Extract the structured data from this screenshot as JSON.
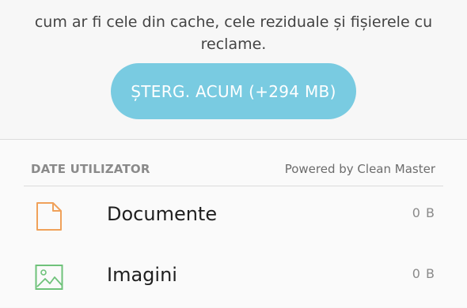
{
  "description": {
    "line1": "cum ar fi cele din cache, cele reziduale și fișierele cu",
    "line2": "reclame."
  },
  "clean_button": {
    "label": "ȘTERG. ACUM (+294 MB)"
  },
  "user_data": {
    "title": "DATE UTILIZATOR",
    "powered_by": "Powered by Clean Master",
    "items": [
      {
        "label": "Documente",
        "size": "0 B",
        "icon": "document-icon",
        "color": "#f0a15a"
      },
      {
        "label": "Imagini",
        "size": "0 B",
        "icon": "image-icon",
        "color": "#6fc27a"
      }
    ]
  },
  "colors": {
    "button": "#79cbe1",
    "background": "#f7f7f7"
  }
}
